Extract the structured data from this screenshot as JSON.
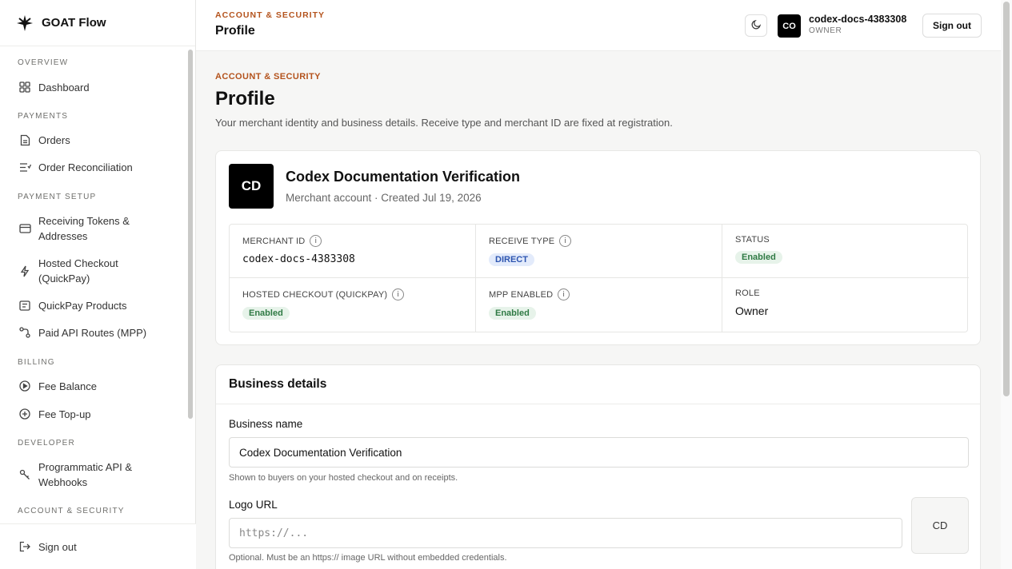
{
  "brand": {
    "name": "GOAT Flow"
  },
  "sidebar": {
    "sections": [
      {
        "title": "OVERVIEW"
      },
      {
        "title": "PAYMENTS"
      },
      {
        "title": "PAYMENT SETUP"
      },
      {
        "title": "BILLING"
      },
      {
        "title": "DEVELOPER"
      },
      {
        "title": "ACCOUNT & SECURITY"
      }
    ],
    "items": [
      {
        "label": "Dashboard",
        "icon": "grid-icon"
      },
      {
        "label": "Orders",
        "icon": "document-icon"
      },
      {
        "label": "Order Reconciliation",
        "icon": "list-check-icon"
      },
      {
        "label": "Receiving Tokens & Addresses",
        "icon": "card-icon"
      },
      {
        "label": "Hosted Checkout (QuickPay)",
        "icon": "lightning-icon"
      },
      {
        "label": "QuickPay Products",
        "icon": "receipt-icon"
      },
      {
        "label": "Paid API Routes (MPP)",
        "icon": "route-icon"
      },
      {
        "label": "Fee Balance",
        "icon": "play-circle-icon"
      },
      {
        "label": "Fee Top-up",
        "icon": "plus-circle-icon"
      },
      {
        "label": "Programmatic API & Webhooks",
        "icon": "key-icon"
      }
    ],
    "footer": {
      "label": "Sign out",
      "icon": "sign-out-icon"
    }
  },
  "topbar": {
    "eyebrow": "ACCOUNT & SECURITY",
    "title": "Profile",
    "avatar": "CO",
    "user_name": "codex-docs-4383308",
    "user_role": "OWNER",
    "signout_label": "Sign out"
  },
  "page": {
    "eyebrow": "ACCOUNT & SECURITY",
    "title": "Profile",
    "description": "Your merchant identity and business details. Receive type and merchant ID are fixed at registration."
  },
  "merchant": {
    "avatar": "CD",
    "name": "Codex Documentation Verification",
    "meta": "Merchant account · Created Jul 19, 2026",
    "fields": {
      "merchant_id": {
        "label": "MERCHANT ID",
        "value": "codex-docs-4383308"
      },
      "receive_type": {
        "label": "RECEIVE TYPE",
        "value": "DIRECT"
      },
      "status": {
        "label": "STATUS",
        "value": "Enabled"
      },
      "hosted_checkout": {
        "label": "HOSTED CHECKOUT (QUICKPAY)",
        "value": "Enabled"
      },
      "mpp_enabled": {
        "label": "MPP ENABLED",
        "value": "Enabled"
      },
      "role": {
        "label": "ROLE",
        "value": "Owner"
      }
    }
  },
  "business": {
    "title": "Business details",
    "name_label": "Business name",
    "name_value": "Codex Documentation Verification",
    "name_hint": "Shown to buyers on your hosted checkout and on receipts.",
    "logo_label": "Logo URL",
    "logo_placeholder": "https://...",
    "logo_hint": "Optional. Must be an https:// image URL without embedded credentials.",
    "logo_preview": "CD"
  },
  "colors": {
    "accent": "#b4531d",
    "badge_green": "#2f7a44",
    "badge_blue": "#2d55b0"
  }
}
